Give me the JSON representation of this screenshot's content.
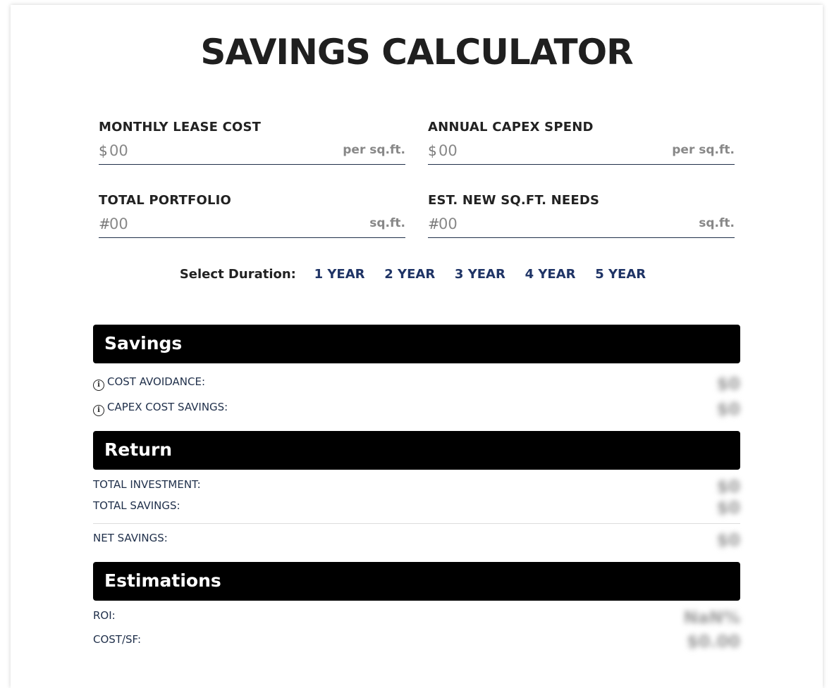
{
  "title": "SAVINGS CALCULATOR",
  "fields": {
    "monthly_lease": {
      "label": "MONTHLY LEASE COST",
      "prefix": "$",
      "placeholder": "00",
      "unit": "per sq.ft."
    },
    "annual_capex": {
      "label": "ANNUAL CAPEX SPEND",
      "prefix": "$",
      "placeholder": "00",
      "unit": "per sq.ft."
    },
    "total_portfolio": {
      "label": "TOTAL PORTFOLIO",
      "prefix": "#",
      "placeholder": "00",
      "unit": "sq.ft."
    },
    "new_sqft": {
      "label": "EST. NEW SQ.FT. NEEDS",
      "prefix": "#",
      "placeholder": "00",
      "unit": "sq.ft."
    }
  },
  "duration": {
    "label": "Select Duration:",
    "options": [
      "1 YEAR",
      "2 YEAR",
      "3 YEAR",
      "4 YEAR",
      "5 YEAR"
    ]
  },
  "savings": {
    "heading": "Savings",
    "cost_avoidance": {
      "label": "COST AVOIDANCE:",
      "value": "$0"
    },
    "capex_savings": {
      "label": "CAPEX COST SAVINGS:",
      "value": "$0"
    }
  },
  "return": {
    "heading": "Return",
    "total_investment": {
      "label": "TOTAL INVESTMENT:",
      "value": "$0"
    },
    "total_savings": {
      "label": "TOTAL SAVINGS:",
      "value": "$0"
    },
    "net_savings": {
      "label": "NET SAVINGS:",
      "value": "$0"
    }
  },
  "estimations": {
    "heading": "Estimations",
    "roi": {
      "label": "ROI:",
      "value": "NaN%"
    },
    "cost_sf": {
      "label": "COST/SF:",
      "value": "$0.00"
    }
  },
  "colors": {
    "accent": "#1f3466",
    "section_bg": "#000000",
    "underline": "#1f2f4a"
  }
}
